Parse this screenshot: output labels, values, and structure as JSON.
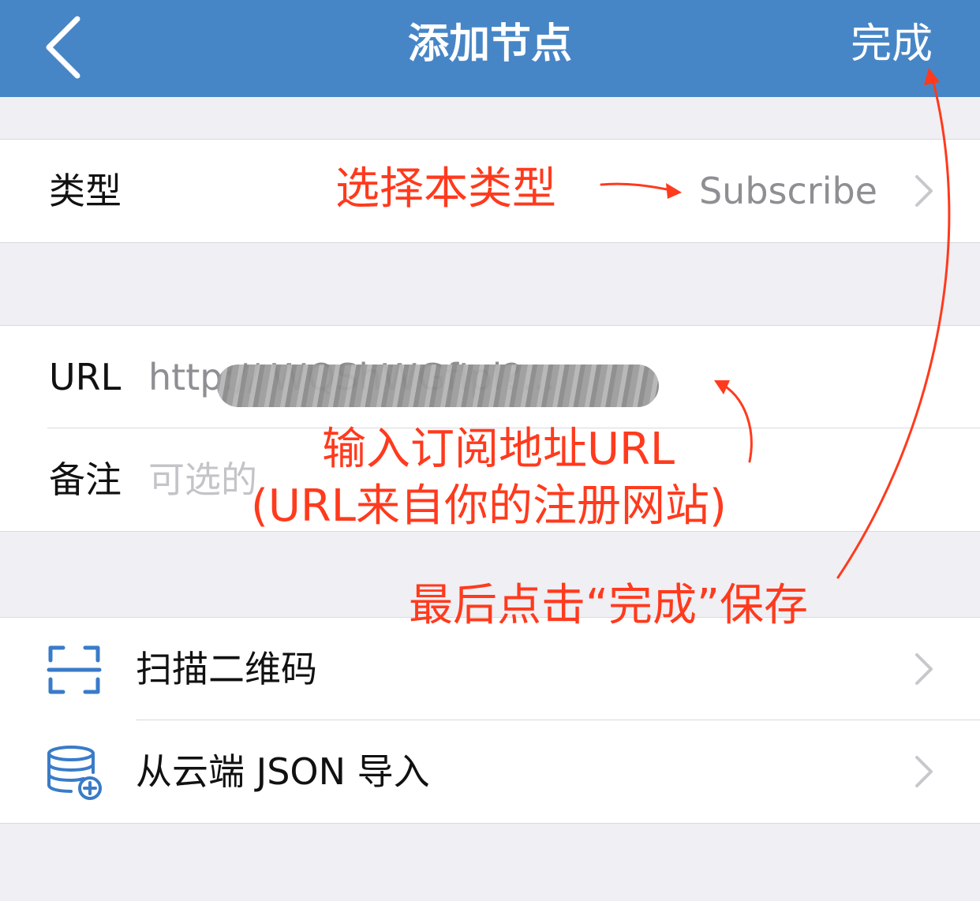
{
  "navbar": {
    "back_icon": "chevron-left-icon",
    "title": "添加节点",
    "done_label": "完成"
  },
  "type_row": {
    "label": "类型",
    "value": "Subscribe"
  },
  "url_row": {
    "label": "URL",
    "value": "http://                                          WQShWGfIpl?..."
  },
  "note_row": {
    "label": "备注",
    "placeholder": "可选的"
  },
  "menu": {
    "scan": {
      "icon": "qr-scan-icon",
      "label": "扫描二维码"
    },
    "import": {
      "icon": "database-plus-icon",
      "label": "从云端 JSON 导入"
    }
  },
  "annotations": {
    "select_type": "选择本类型",
    "enter_url_line1": "输入订阅地址URL",
    "enter_url_line2": "(URL来自你的注册网站)",
    "save": "最后点击“完成”保存"
  },
  "colors": {
    "navbar": "#4786c6",
    "background": "#efeff4",
    "annotation": "#ff3a1d",
    "icon": "#3a7bc8"
  }
}
